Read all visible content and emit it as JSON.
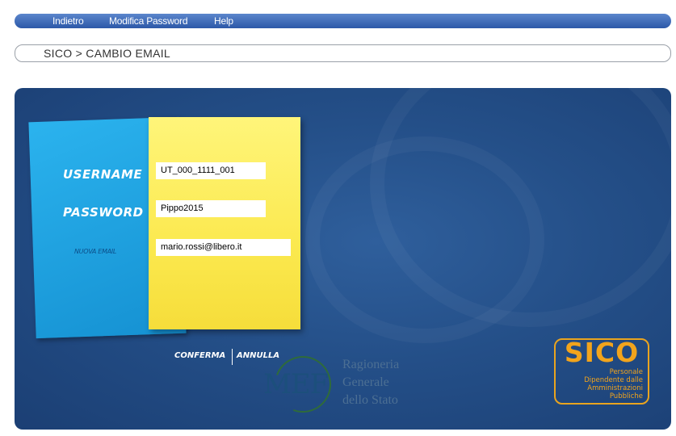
{
  "nav": {
    "back": "Indietro",
    "change_password": "Modifica Password",
    "help": "Help"
  },
  "breadcrumb": "SICO > CAMBIO EMAIL",
  "form": {
    "username_label": "USERNAME",
    "username_value": "UT_000_1111_001",
    "password_label": "PASSWORD",
    "password_value": "Pippo2015",
    "email_label": "NUOVA EMAIL",
    "email_value": "mario.rossi@libero.it"
  },
  "actions": {
    "confirm": "CONFERMA",
    "cancel": "ANNULLA"
  },
  "mef": {
    "logo": "MEF",
    "line1": "Ragioneria",
    "line2": "Generale",
    "line3": "dello Stato"
  },
  "sico": {
    "title": "SICO",
    "line1": "Personale",
    "line2": "Dipendente dalle",
    "line3": "Amministrazioni",
    "line4": "Pubbliche"
  },
  "colors": {
    "panel": "#244f88",
    "note_blue": "#1ea3e2",
    "note_yellow": "#fbe94f",
    "sico_orange": "#f2a41c"
  }
}
